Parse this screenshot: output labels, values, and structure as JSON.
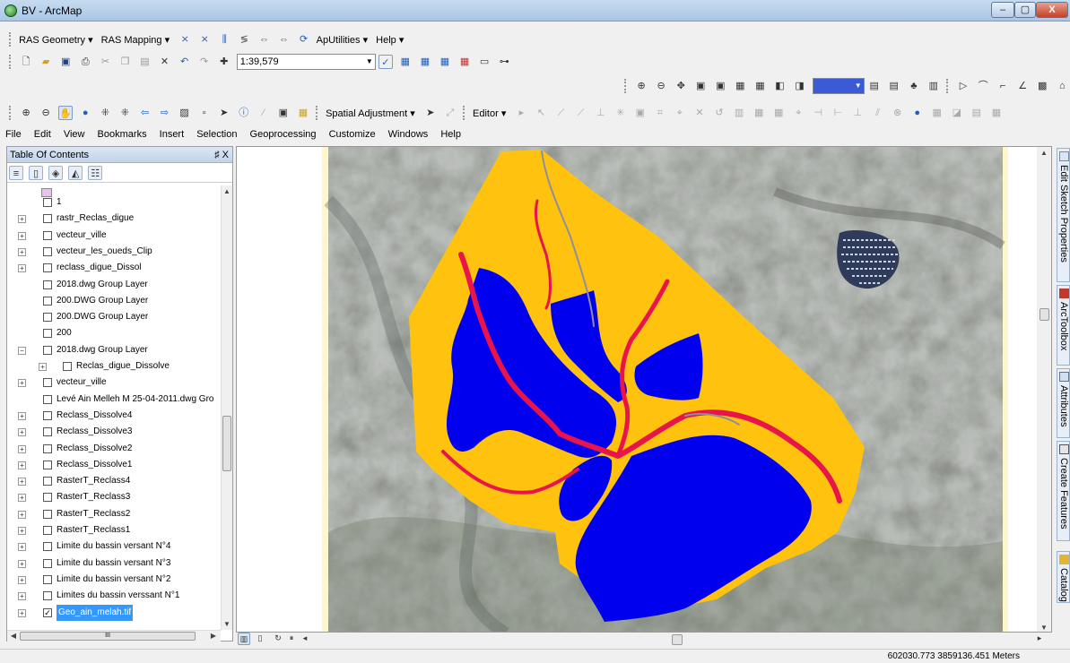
{
  "window": {
    "title": "BV - ArcMap",
    "min": "–",
    "max": "▢",
    "close": "X"
  },
  "toolbars": {
    "ras_geometry": "RAS Geometry",
    "ras_mapping": "RAS Mapping",
    "aputilities": "ApUtilities",
    "help": "Help",
    "scale": "1:39,579",
    "spatial_adjustment": "Spatial Adjustment",
    "editor": "Editor"
  },
  "menu": [
    "File",
    "Edit",
    "View",
    "Bookmarks",
    "Insert",
    "Selection",
    "Geoprocessing",
    "Customize",
    "Windows",
    "Help"
  ],
  "toc": {
    "title": "Table Of Contents",
    "pin": "♯ X",
    "items": [
      {
        "label": "1",
        "indent": 2,
        "expand": "",
        "checked": false
      },
      {
        "label": "rastr_Reclas_digue",
        "indent": 1,
        "expand": "+",
        "checked": false
      },
      {
        "label": "vecteur_ville",
        "indent": 1,
        "expand": "+",
        "checked": false
      },
      {
        "label": "vecteur_les_oueds_Clip",
        "indent": 1,
        "expand": "+",
        "checked": false
      },
      {
        "label": "reclass_digue_Dissol",
        "indent": 1,
        "expand": "+",
        "checked": false
      },
      {
        "label": "2018.dwg Group Layer",
        "indent": 2,
        "expand": "",
        "checked": false
      },
      {
        "label": "200.DWG Group Layer",
        "indent": 2,
        "expand": "",
        "checked": false
      },
      {
        "label": "200.DWG Group Layer",
        "indent": 2,
        "expand": "",
        "checked": false
      },
      {
        "label": "200",
        "indent": 2,
        "expand": "",
        "checked": false
      },
      {
        "label": "2018.dwg Group Layer",
        "indent": 1,
        "expand": "−",
        "checked": false
      },
      {
        "label": "Reclas_digue_Dissolve",
        "indent": 3,
        "expand": "+",
        "checked": false
      },
      {
        "label": "vecteur_ville",
        "indent": 1,
        "expand": "+",
        "checked": false
      },
      {
        "label": "Levé Ain Melleh M 25-04-2011.dwg Gro",
        "indent": 2,
        "expand": "",
        "checked": false
      },
      {
        "label": "Reclass_Dissolve4",
        "indent": 1,
        "expand": "+",
        "checked": false
      },
      {
        "label": "Reclass_Dissolve3",
        "indent": 1,
        "expand": "+",
        "checked": false
      },
      {
        "label": "Reclass_Dissolve2",
        "indent": 1,
        "expand": "+",
        "checked": false
      },
      {
        "label": "Reclass_Dissolve1",
        "indent": 1,
        "expand": "+",
        "checked": false
      },
      {
        "label": "RasterT_Reclass4",
        "indent": 1,
        "expand": "+",
        "checked": false
      },
      {
        "label": "RasterT_Reclass3",
        "indent": 1,
        "expand": "+",
        "checked": false
      },
      {
        "label": "RasterT_Reclass2",
        "indent": 1,
        "expand": "+",
        "checked": false
      },
      {
        "label": "RasterT_Reclass1",
        "indent": 1,
        "expand": "+",
        "checked": false
      },
      {
        "label": "Limite du bassin versant N°4",
        "indent": 1,
        "expand": "+",
        "checked": false
      },
      {
        "label": "Limite du bassin versant N°3",
        "indent": 1,
        "expand": "+",
        "checked": false
      },
      {
        "label": "Limite du bassin versant N°2",
        "indent": 1,
        "expand": "+",
        "checked": false
      },
      {
        "label": "Limites du bassin verssant N°1",
        "indent": 1,
        "expand": "+",
        "checked": false
      },
      {
        "label": "Geo_ain_melah.tif",
        "indent": 1,
        "expand": "+",
        "checked": true,
        "selected": true
      }
    ],
    "hscroll_thumb": "III"
  },
  "side_tabs": [
    "Edit Sketch Properties",
    "ArcToolbox",
    "Attributes",
    "Create Features",
    "Catalog"
  ],
  "status": {
    "coordinates": "602030.773 3859136.451 Meters"
  },
  "colors": {
    "watershed": "#ffc20e",
    "zones": "#0000ee",
    "wadis": "#e8144a",
    "imagery": "#8b8e88"
  }
}
